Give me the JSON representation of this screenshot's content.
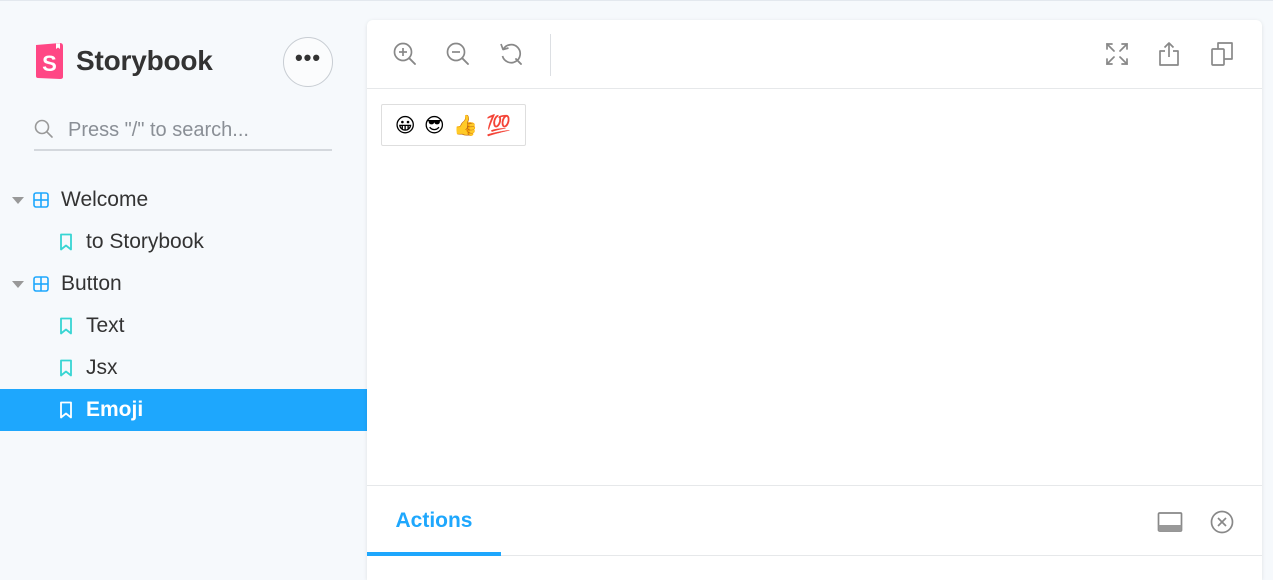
{
  "brand": {
    "name": "Storybook",
    "logo_letter": "S",
    "logo_color": "#ff4785"
  },
  "sidebar": {
    "menu_glyph": "•••",
    "search": {
      "placeholder": "Press \"/\" to search...",
      "value": ""
    },
    "tree": [
      {
        "type": "component",
        "label": "Welcome",
        "expanded": true
      },
      {
        "type": "story",
        "label": "to Storybook",
        "selected": false
      },
      {
        "type": "component",
        "label": "Button",
        "expanded": true
      },
      {
        "type": "story",
        "label": "Text",
        "selected": false
      },
      {
        "type": "story",
        "label": "Jsx",
        "selected": false
      },
      {
        "type": "story",
        "label": "Emoji",
        "selected": true
      }
    ]
  },
  "toolbar": {
    "left_tools": [
      "zoom-in-icon",
      "zoom-out-icon",
      "reset-zoom-icon"
    ],
    "right_tools": [
      "fullscreen-icon",
      "share-icon",
      "copy-icon"
    ]
  },
  "preview": {
    "button_label": "😀 😎 👍 💯"
  },
  "addons": {
    "active_tab": "Actions",
    "tools": [
      "panel-orientation-icon",
      "close-panel-icon"
    ]
  },
  "colors": {
    "accent": "#1ea7fd",
    "sidebar_bg": "#f6f9fc",
    "story_icon": "#37d5d3",
    "component_icon": "#1ea7fd"
  }
}
